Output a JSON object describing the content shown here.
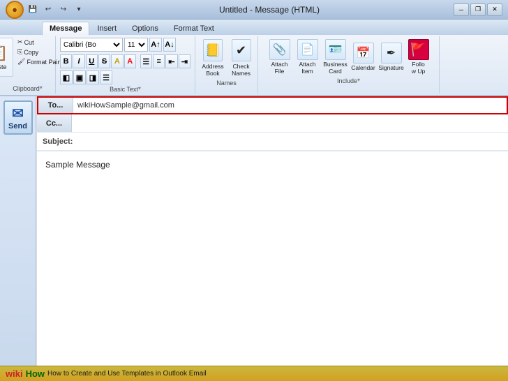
{
  "titleBar": {
    "title": "Untitled - Message (HTML)",
    "officeBtn": "●",
    "qatBtns": [
      "💾",
      "↩",
      "↪",
      "▾"
    ]
  },
  "tabs": [
    {
      "label": "Message",
      "active": true
    },
    {
      "label": "Insert",
      "active": false
    },
    {
      "label": "Options",
      "active": false
    },
    {
      "label": "Format Text",
      "active": false
    }
  ],
  "clipboard": {
    "pasteLabel": "Paste",
    "cutLabel": "Cut",
    "copyLabel": "Copy",
    "formatPainterLabel": "Format Painter",
    "groupLabel": "Clipboard"
  },
  "basicText": {
    "fontName": "Calibri (Bo",
    "fontSize": "11",
    "groupLabel": "Basic Text"
  },
  "names": {
    "addressBook": "Address\nBook",
    "checkNames": "Check\nNames",
    "groupLabel": "Names"
  },
  "include": {
    "attachFile": "Attach\nFile",
    "attachItem": "Attach\nItem",
    "businessCard": "Business\nCard",
    "calendar": "Calendar",
    "signature": "Signature",
    "followUp": "Follo\nw Up",
    "groupLabel": "Include"
  },
  "email": {
    "toLabel": "To...",
    "ccLabel": "Cc...",
    "subjectLabel": "Subject:",
    "toValue": "wikiHowSample@gmail.com",
    "ccValue": "",
    "subjectValue": ""
  },
  "sendBtn": "Send",
  "messageBody": "Sample Message",
  "bottomBar": {
    "wikiText": "wiki",
    "howText": "How",
    "articleText": "How to Create and Use Templates in Outlook Email"
  },
  "windowControls": {
    "minimize": "─",
    "restore": "❐",
    "close": "✕"
  }
}
